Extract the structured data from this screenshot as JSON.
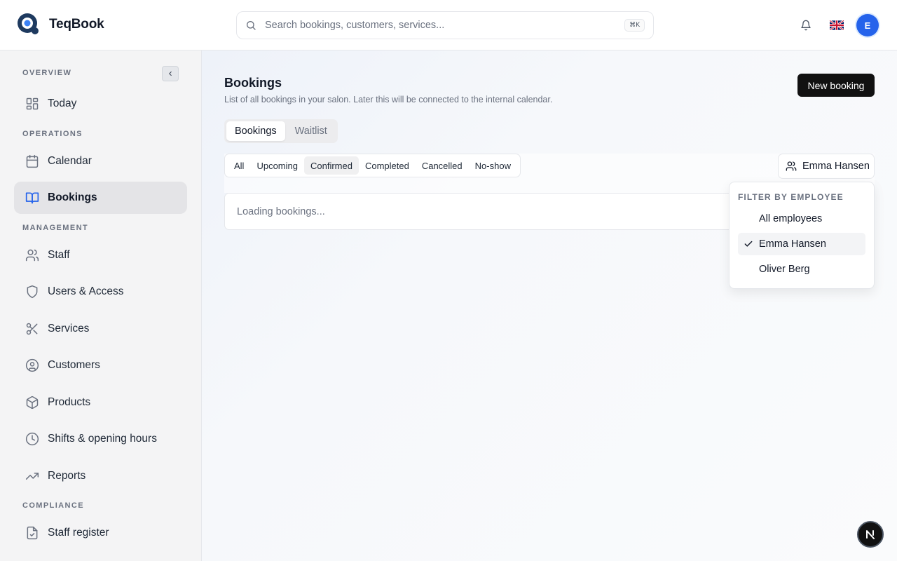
{
  "app": {
    "name": "TeqBook"
  },
  "search": {
    "placeholder": "Search bookings, customers, services...",
    "shortcut": "⌘K"
  },
  "user": {
    "initial": "E"
  },
  "sidebar": {
    "sections": {
      "overview": "OVERVIEW",
      "operations": "OPERATIONS",
      "management": "MANAGEMENT",
      "compliance": "COMPLIANCE"
    },
    "items": {
      "today": "Today",
      "calendar": "Calendar",
      "bookings": "Bookings",
      "staff": "Staff",
      "users": "Users & Access",
      "services": "Services",
      "customers": "Customers",
      "products": "Products",
      "shifts": "Shifts & opening hours",
      "reports": "Reports",
      "register": "Staff register"
    },
    "active": "bookings"
  },
  "page": {
    "title": "Bookings",
    "subtitle": "List of all bookings in your salon. Later this will be connected to the internal calendar.",
    "new_button": "New booking"
  },
  "tabs": {
    "bookings": "Bookings",
    "waitlist": "Waitlist",
    "active": "bookings"
  },
  "status_filters": {
    "all": "All",
    "upcoming": "Upcoming",
    "confirmed": "Confirmed",
    "completed": "Completed",
    "cancelled": "Cancelled",
    "noshow": "No-show",
    "active": "confirmed"
  },
  "employee_filter": {
    "selected": "Emma Hansen",
    "menu_label": "Filter by employee",
    "options": [
      "All employees",
      "Emma Hansen",
      "Oliver Berg"
    ]
  },
  "loading_text": "Loading bookings...",
  "badge": {
    "letter": "N"
  }
}
